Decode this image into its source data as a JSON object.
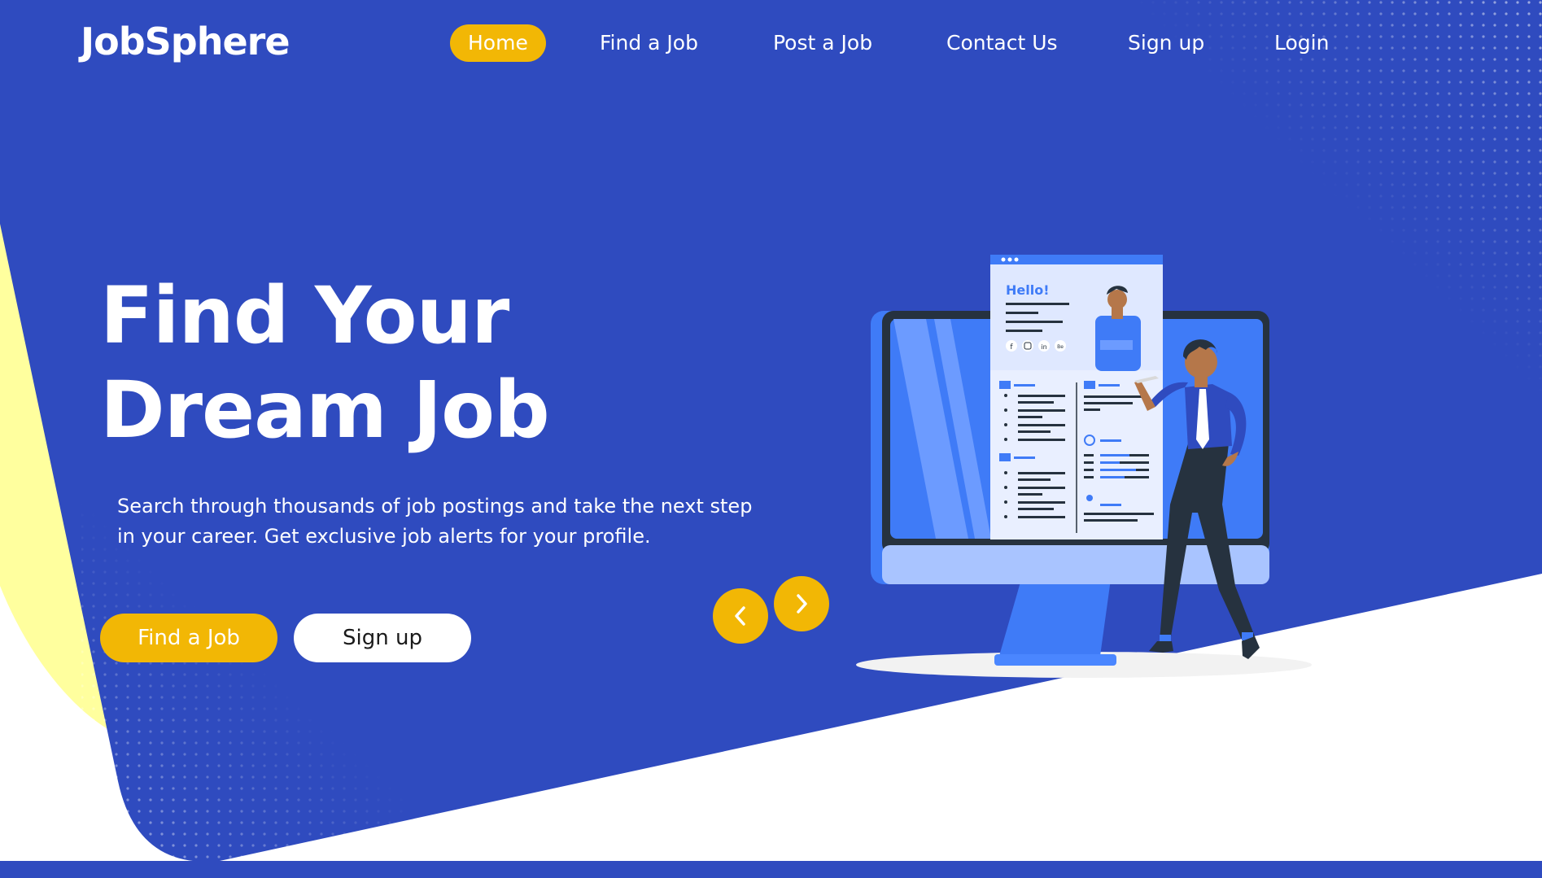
{
  "brand": {
    "name": "JobSphere"
  },
  "nav": {
    "items": [
      {
        "label": "Home",
        "active": true
      },
      {
        "label": "Find a Job",
        "active": false
      },
      {
        "label": "Post a Job",
        "active": false
      },
      {
        "label": "Contact Us",
        "active": false
      },
      {
        "label": "Sign up",
        "active": false
      },
      {
        "label": "Login",
        "active": false
      }
    ]
  },
  "hero": {
    "title_line1": "Find Your",
    "title_line2": "Dream Job",
    "subtitle_line1": "Search through thousands of job postings and take the next step",
    "subtitle_line2": "in your career. Get exclusive job alerts for your profile.",
    "primary_button": "Find a Job",
    "secondary_button": "Sign up",
    "prev_icon": "chevron-left-icon",
    "next_icon": "chevron-right-icon"
  },
  "illustration": {
    "greeting": "Hello!",
    "social_labels": [
      "f",
      "in",
      "Be"
    ]
  },
  "colors": {
    "primary_blue": "#2f4bbf",
    "accent_yellow": "#f2b705",
    "pale_yellow": "#ffff9e",
    "white": "#ffffff"
  }
}
